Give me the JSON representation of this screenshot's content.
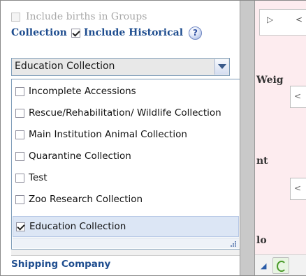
{
  "left": {
    "births_label": "Include births in Groups",
    "collection_label": "Collection",
    "include_historical_label": "Include Historical",
    "include_historical_checked": true,
    "help_icon": "help-icon",
    "collection_select": {
      "selected_value": "Education Collection"
    },
    "options": [
      {
        "label": "Incomplete Accessions",
        "checked": false
      },
      {
        "label": "Rescue/Rehabilitation/ Wildlife Collection",
        "checked": false
      },
      {
        "label": "Main Institution Animal Collection",
        "checked": false
      },
      {
        "label": "Quarantine Collection",
        "checked": false
      },
      {
        "label": "Test",
        "checked": false
      },
      {
        "label": "Zoo Research Collection",
        "checked": false
      },
      {
        "label": "Education Collection",
        "checked": true
      }
    ],
    "shipping_label": "Shipping Company"
  },
  "right": {
    "labels": [
      "Weig",
      "nt",
      "lo"
    ],
    "nav_glyph_left": "▷",
    "nav_glyph_right": "<"
  }
}
